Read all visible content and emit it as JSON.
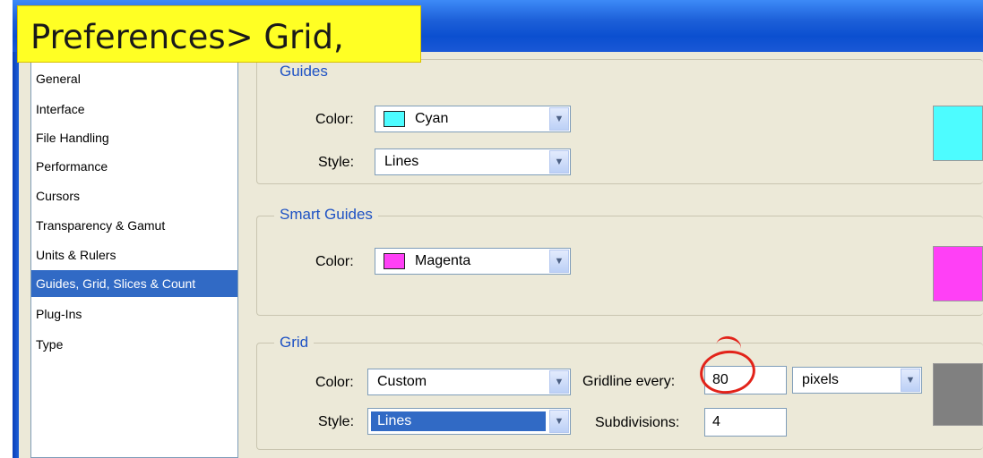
{
  "annotation": {
    "text": "Preferences> Grid,"
  },
  "sidebar": {
    "items": [
      {
        "label": "General"
      },
      {
        "label": "Interface"
      },
      {
        "label": "File Handling"
      },
      {
        "label": "Performance"
      },
      {
        "label": "Cursors"
      },
      {
        "label": "Transparency & Gamut"
      },
      {
        "label": "Units & Rulers"
      },
      {
        "label": "Guides, Grid, Slices & Count",
        "selected": true
      },
      {
        "label": "Plug-Ins"
      },
      {
        "label": "Type"
      }
    ]
  },
  "guides": {
    "legend": "Guides",
    "color_label": "Color:",
    "color_value": "Cyan",
    "color_hex": "#4dfcff",
    "style_label": "Style:",
    "style_value": "Lines"
  },
  "smart_guides": {
    "legend": "Smart Guides",
    "color_label": "Color:",
    "color_value": "Magenta",
    "color_hex": "#ff40f6"
  },
  "grid": {
    "legend": "Grid",
    "color_label": "Color:",
    "color_value": "Custom",
    "color_hex": "#808080",
    "style_label": "Style:",
    "style_value": "Lines",
    "gridline_label": "Gridline every:",
    "gridline_value": "80",
    "units_value": "pixels",
    "subdivisions_label": "Subdivisions:",
    "subdivisions_value": "4"
  }
}
